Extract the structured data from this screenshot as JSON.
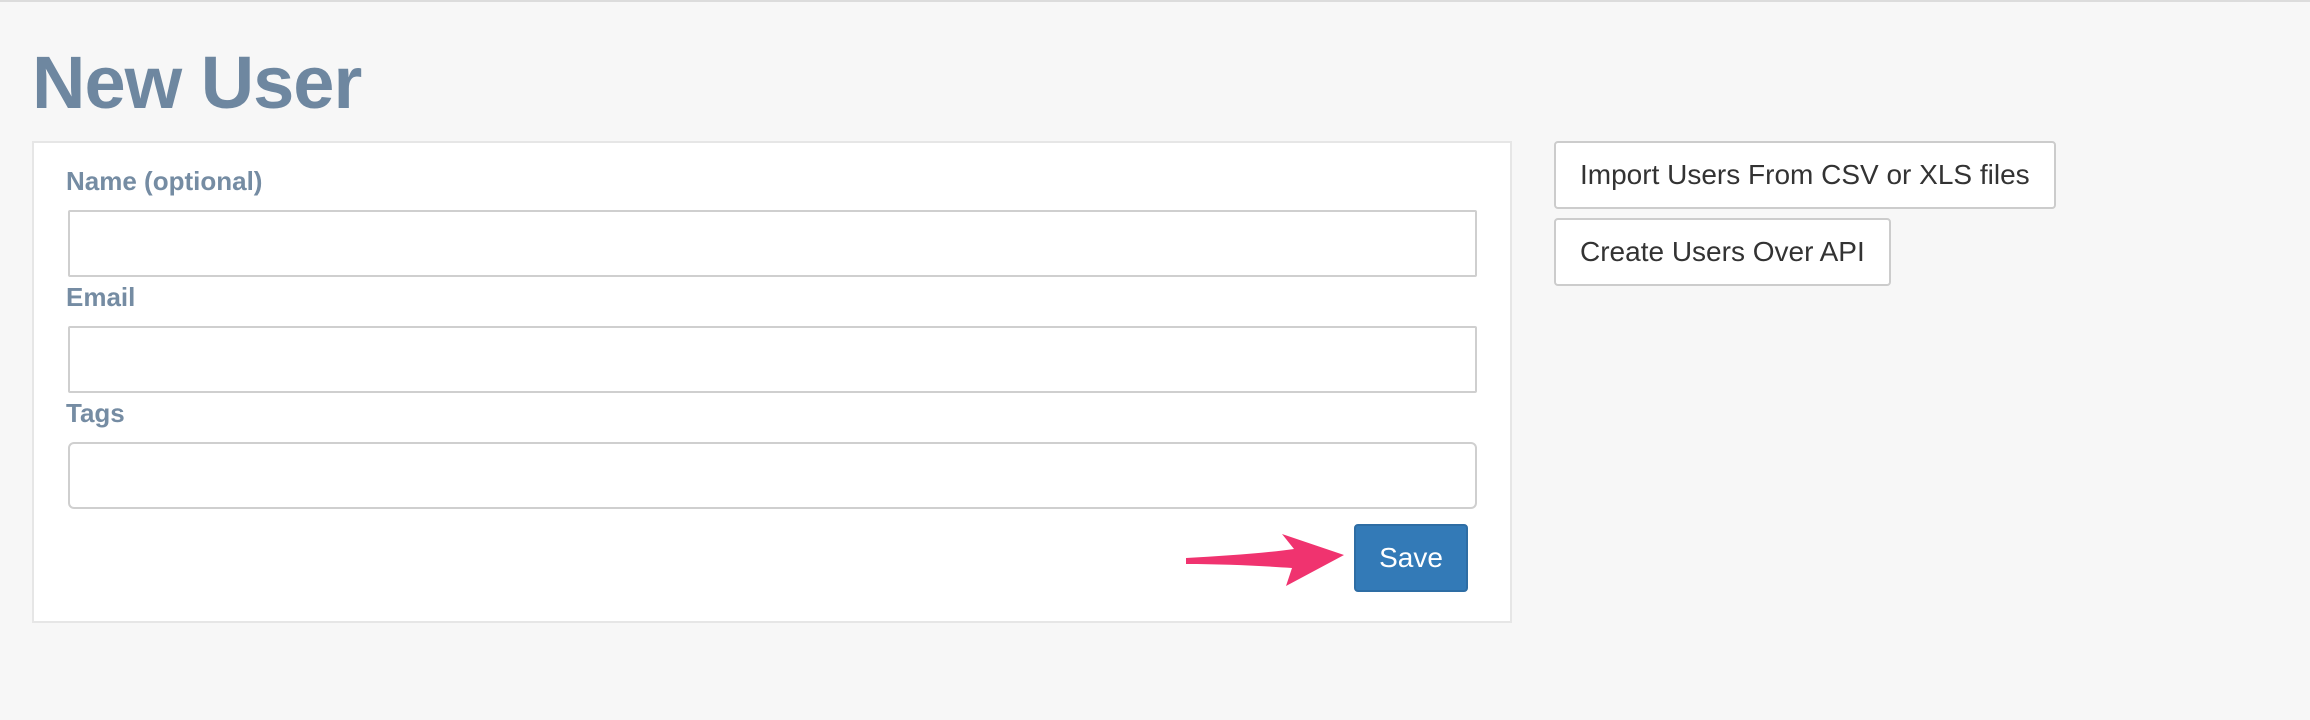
{
  "page": {
    "title": "New User"
  },
  "form": {
    "fields": [
      {
        "label": "Name (optional)",
        "value": "",
        "placeholder": ""
      },
      {
        "label": "Email",
        "value": "",
        "placeholder": ""
      },
      {
        "label": "Tags",
        "value": "",
        "placeholder": ""
      }
    ],
    "save_label": "Save"
  },
  "side_actions": {
    "import_label": "Import Users From CSV or XLS files",
    "api_label": "Create Users Over API"
  },
  "annotation": {
    "arrow_icon": "arrow-right-icon",
    "arrow_color": "#f0336f"
  },
  "colors": {
    "title": "#6e87a0",
    "label": "#758ca3",
    "primary": "#337ab7",
    "background": "#f7f7f7"
  }
}
